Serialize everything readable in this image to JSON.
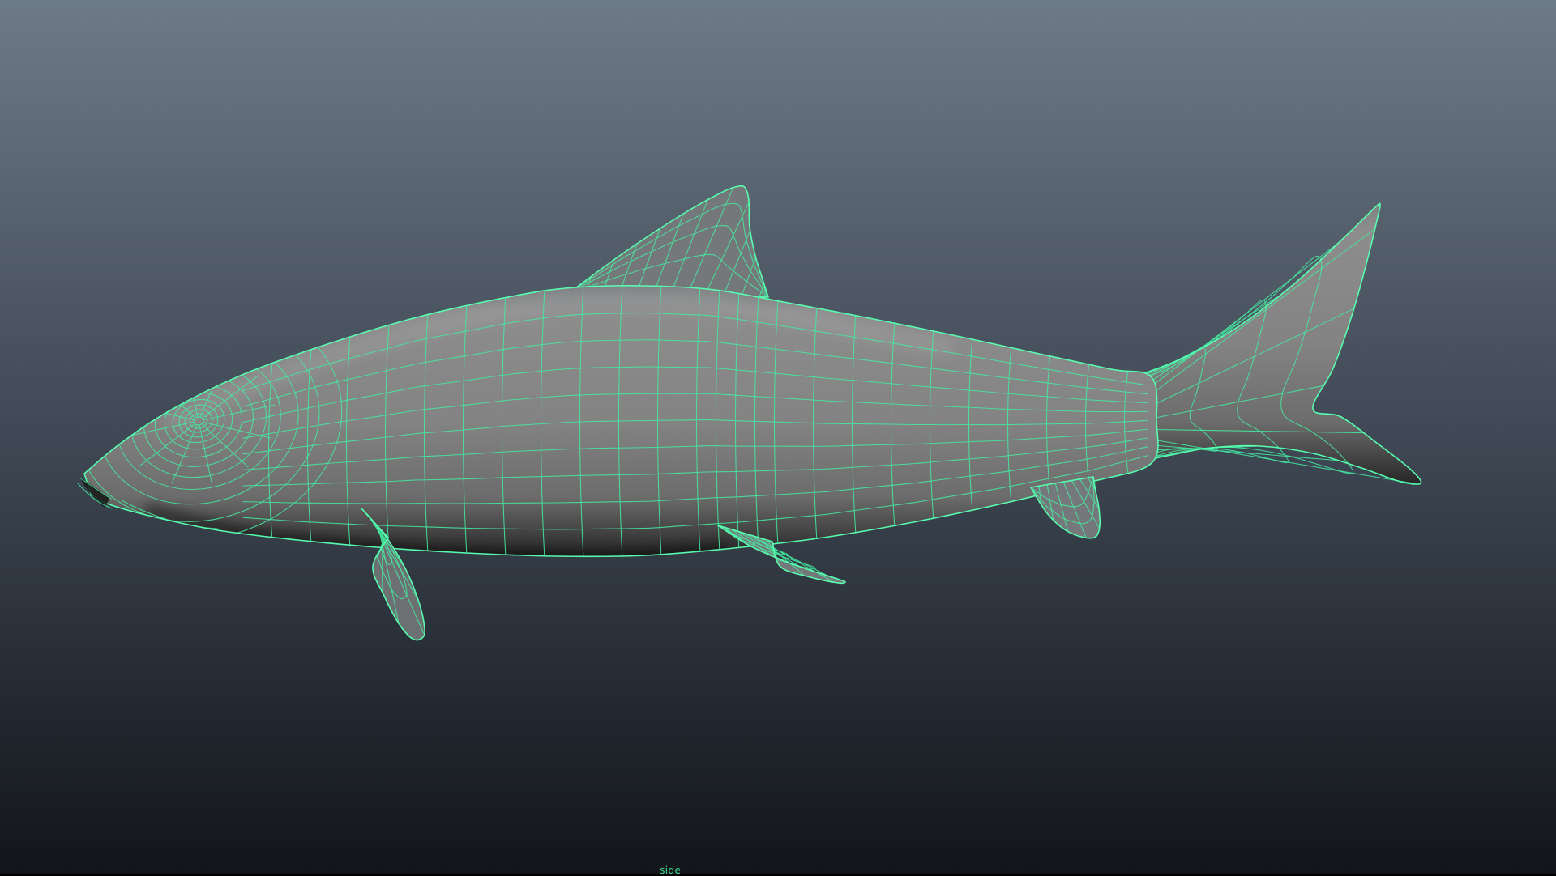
{
  "viewport": {
    "camera_label": "side",
    "model": {
      "display_mode": "wireframe-on-shaded",
      "selected": true
    },
    "colors": {
      "background_top": "#6d7a87",
      "background_mid": "#3d4652",
      "background_bottom": "#12151a",
      "wireframe": "#46e8a0",
      "wireframe_bright": "#58ffb0",
      "body_light": "#8d8d8d",
      "body_mid": "#838383",
      "body_dark": "#262626",
      "fin_fill": "#75787a",
      "pectoral_fill": "#6d7072",
      "label_color": "#3fd88f"
    }
  }
}
